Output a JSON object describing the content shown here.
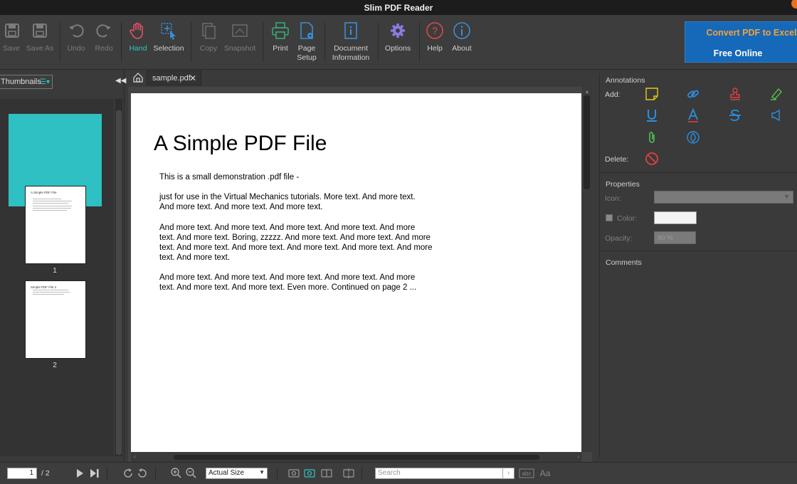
{
  "window": {
    "title": "Slim PDF Reader"
  },
  "toolbar": {
    "save": "Save",
    "save_as": "Save As",
    "undo": "Undo",
    "redo": "Redo",
    "hand": "Hand",
    "selection": "Selection",
    "copy": "Copy",
    "snapshot": "Snapshot",
    "print": "Print",
    "page_setup_1": "Page",
    "page_setup_2": "Setup",
    "doc_info_1": "Document",
    "doc_info_2": "Information",
    "options": "Options",
    "help": "Help",
    "about": "About"
  },
  "promo": {
    "line1": "Convert PDF to Excel",
    "line2": "Free Online"
  },
  "left_panel": {
    "view_select": "Thumbnails",
    "thumbnails": [
      {
        "number": "1",
        "title": "A Simple PDF File",
        "selected": true
      },
      {
        "number": "2",
        "title": "Simple PDF File 2",
        "selected": false
      }
    ]
  },
  "tab": {
    "label": "sample.pdf",
    "close": "✕"
  },
  "document": {
    "heading": "A Simple PDF File",
    "paragraphs": [
      "This is a small demonstration .pdf file -",
      "just for use in the Virtual Mechanics tutorials. More text. And more text. And more text. And more text. And more text.",
      "And more text. And more text. And more text. And more text. And more text. And more text. Boring, zzzzz. And more text. And more text. And more text. And more text. And more text. And more text. And more text. And more text. And more text.",
      "And more text. And more text. And more text. And more text. And more text. And more text. And more text. Even more. Continued on page 2 ..."
    ]
  },
  "right_panel": {
    "annotations_title": "Annotations",
    "add_label": "Add:",
    "delete_label": "Delete:",
    "properties_title": "Properties",
    "icon_label": "Icon:",
    "color_label": "Color:",
    "opacity_label": "Opacity:",
    "opacity_value": "80 %",
    "comments_title": "Comments"
  },
  "status_bar": {
    "current_page": "1",
    "total_pages": "/ 2",
    "zoom": "Actual Size",
    "search_placeholder": "Search"
  },
  "colors": {
    "accent": "#2fc4c4",
    "annotation_yellow": "#e8c81a",
    "annotation_blue": "#2a8fe0",
    "annotation_red": "#e04040",
    "annotation_green": "#4ec44e",
    "promo_bg": "#1668b8",
    "promo_orange": "#f2a33a"
  }
}
